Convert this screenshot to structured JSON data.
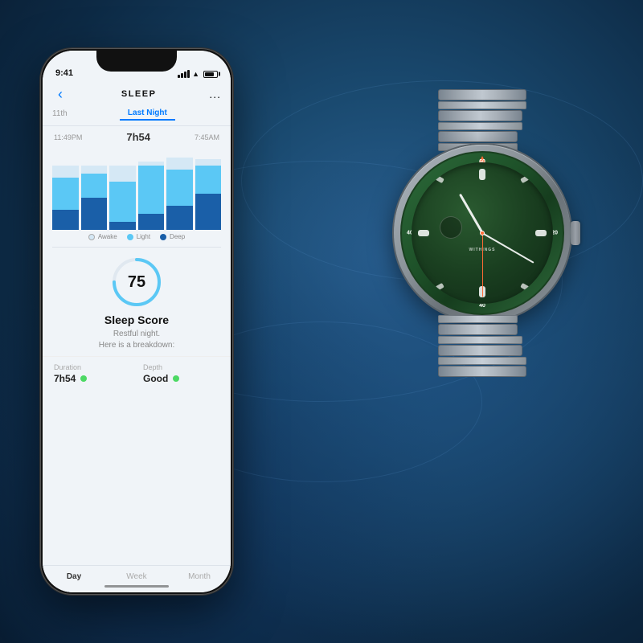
{
  "background": {
    "color": "#1a3a5c"
  },
  "phone": {
    "status_bar": {
      "time": "9:41"
    },
    "header": {
      "title": "SLEEP",
      "back_label": "<",
      "more_label": "..."
    },
    "date_nav": {
      "prev_date": "11th",
      "tabs": [
        {
          "label": "Last Night",
          "active": true
        }
      ]
    },
    "sleep_times": {
      "start": "11:49PM",
      "duration": "7h54",
      "end": "7:45AM"
    },
    "chart": {
      "legend": [
        {
          "label": "Awake",
          "color": "#d5e8f5"
        },
        {
          "label": "Light",
          "color": "#5bc8f5"
        },
        {
          "label": "Deep",
          "color": "#1a5fa8"
        }
      ],
      "bars": [
        {
          "awake": 15,
          "light": 40,
          "deep": 25
        },
        {
          "awake": 10,
          "light": 30,
          "deep": 40
        },
        {
          "awake": 20,
          "light": 50,
          "deep": 10
        },
        {
          "awake": 5,
          "light": 60,
          "deep": 20
        },
        {
          "awake": 15,
          "light": 45,
          "deep": 30
        },
        {
          "awake": 8,
          "light": 35,
          "deep": 45
        }
      ]
    },
    "sleep_score": {
      "value": 75,
      "label": "Sleep Score",
      "description": "Restful night.\nHere is a breakdown:",
      "max": 100
    },
    "stats": [
      {
        "label": "Duration",
        "value": "7h54",
        "status": "good",
        "dot_color": "#4cd964"
      },
      {
        "label": "Depth",
        "value": "Good",
        "status": "good",
        "dot_color": "#4cd964"
      }
    ],
    "bottom_tabs": [
      {
        "label": "Day",
        "active": true
      },
      {
        "label": "Week",
        "active": false
      },
      {
        "label": "Month",
        "active": false
      }
    ]
  },
  "watch": {
    "brand": "WITHINGS",
    "triangle_color": "#ff6b35"
  }
}
